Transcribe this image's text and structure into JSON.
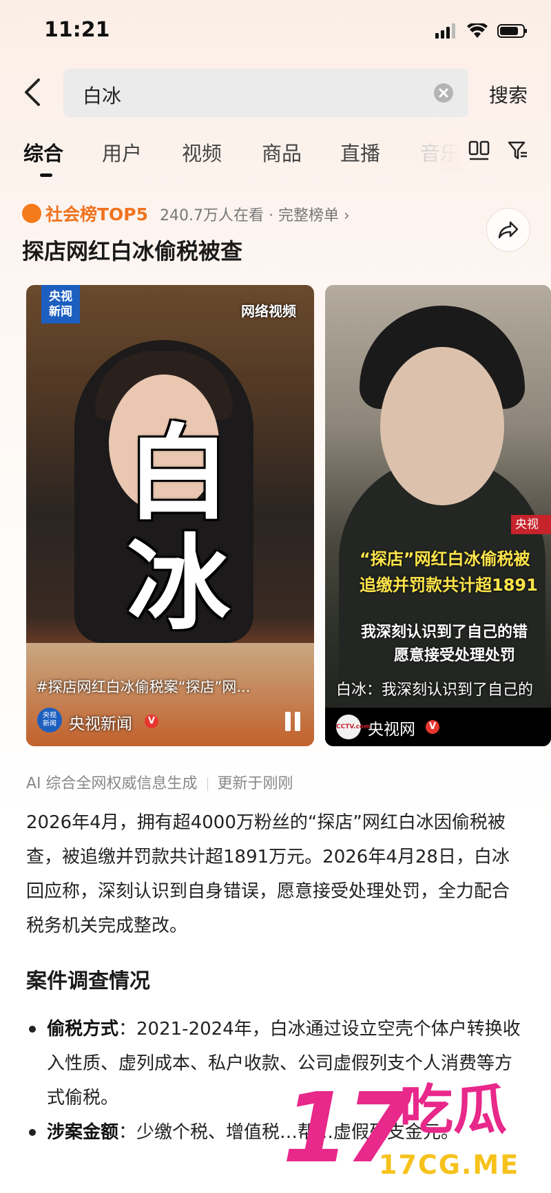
{
  "status_bar": {
    "time": "11:21"
  },
  "search": {
    "query": "白冰",
    "submit_label": "搜索"
  },
  "tabs": [
    {
      "label": "综合"
    },
    {
      "label": "用户"
    },
    {
      "label": "视频"
    },
    {
      "label": "商品"
    },
    {
      "label": "直播"
    },
    {
      "label": "音乐"
    }
  ],
  "hot": {
    "rank_label": "社会榜TOP5",
    "viewers": "240.7万人在看",
    "full_list": "· 完整榜单 ›",
    "headline": "探店网红白冰偷税被查"
  },
  "cards": [
    {
      "logo": "央视\n新闻",
      "watermark": "网络视频",
      "big_text_1": "白",
      "big_text_2": "冰",
      "caption": "#探店网红白冰偷税案“探店”网...",
      "source": "央视新闻",
      "avatar_text": "央视\n新闻"
    },
    {
      "corner_tag": "央视",
      "sub_line_1": "“探店”网红白冰偷税被",
      "sub_line_2": "追缴并罚款共计超1891",
      "sub_line_3": "我深刻认识到了自己的错",
      "sub_line_4": "愿意接受处理处罚",
      "caption": "白冰：我深刻认识到了自己的",
      "source": "央视网",
      "logo_text": "CCTV.com"
    }
  ],
  "ai": {
    "source_note": "AI 综合全网权威信息生成",
    "updated": "更新于刚刚",
    "summary": "2026年4月，拥有超4000万粉丝的“探店”网红白冰因偷税被查，被追缴并罚款共计超1891万元。2026年4月28日，白冰回应称，深刻认识到自身错误，愿意接受处理处罚，全力配合税务机关完成整改。",
    "section_title": "案件调查情况",
    "bullets": [
      {
        "term": "偷税方式",
        "text": "：2021-2024年，白冰通过设立空壳个体户转换收入性质、虚列成本、私户收款、公司虚假列支个人消费等方式偷税。"
      },
      {
        "term": "涉案金额",
        "text": "：少缴个税、增值税…帮…虚假列支金元。"
      }
    ]
  },
  "watermark": {
    "number": "17",
    "name": "吃瓜",
    "url": "17CG.ME"
  },
  "colors": {
    "hot_orange": "#f0731f",
    "vbadge_red": "#e8362f",
    "subtitle_yellow": "#ffe54a",
    "watermark_pink": "#e8288a",
    "watermark_gold": "#f6c21b"
  }
}
